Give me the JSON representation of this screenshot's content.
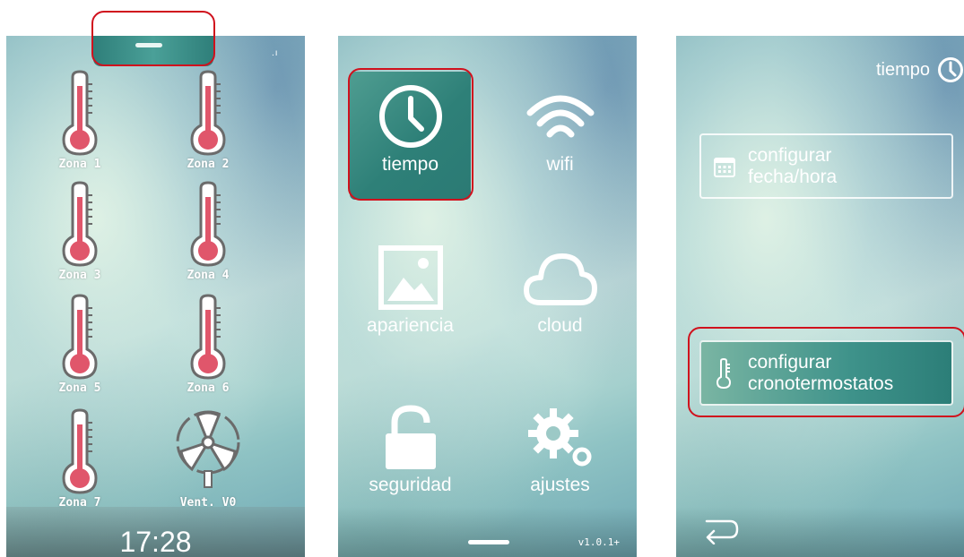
{
  "screen1": {
    "zones": [
      {
        "label": "Zona 1"
      },
      {
        "label": "Zona 2"
      },
      {
        "label": "Zona 3"
      },
      {
        "label": "Zona 4"
      },
      {
        "label": "Zona 5"
      },
      {
        "label": "Zona 6"
      },
      {
        "label": "Zona 7"
      },
      {
        "label": "Vent. V0"
      }
    ],
    "clock": "17:28",
    "status_indicator": ".ı",
    "icons": {
      "zone": "thermometer-icon",
      "fan": "fan-icon"
    },
    "colors": {
      "thermometer_fill": "#e0566b",
      "pull_tab": "#3a8f89"
    }
  },
  "screen2": {
    "menu": [
      {
        "label": "tiempo",
        "icon": "clock-icon"
      },
      {
        "label": "wifi",
        "icon": "wifi-icon"
      },
      {
        "label": "apariencia",
        "icon": "image-icon"
      },
      {
        "label": "cloud",
        "icon": "cloud-icon"
      },
      {
        "label": "seguridad",
        "icon": "unlock-icon"
      },
      {
        "label": "ajustes",
        "icon": "gear-icon"
      }
    ],
    "version": "v1.0.1+",
    "colors": {
      "active_tile": "#2e8078"
    }
  },
  "screen3": {
    "title": "tiempo",
    "title_icon": "clock-icon",
    "buttons": [
      {
        "line1": "configurar",
        "line2": "fecha/hora",
        "icon": "calendar-icon"
      },
      {
        "line1": "configurar",
        "line2": "cronotermostatos",
        "icon": "thermometer-icon"
      }
    ],
    "back_icon": "back-arrow-icon"
  },
  "highlight_color": "#d0111d"
}
